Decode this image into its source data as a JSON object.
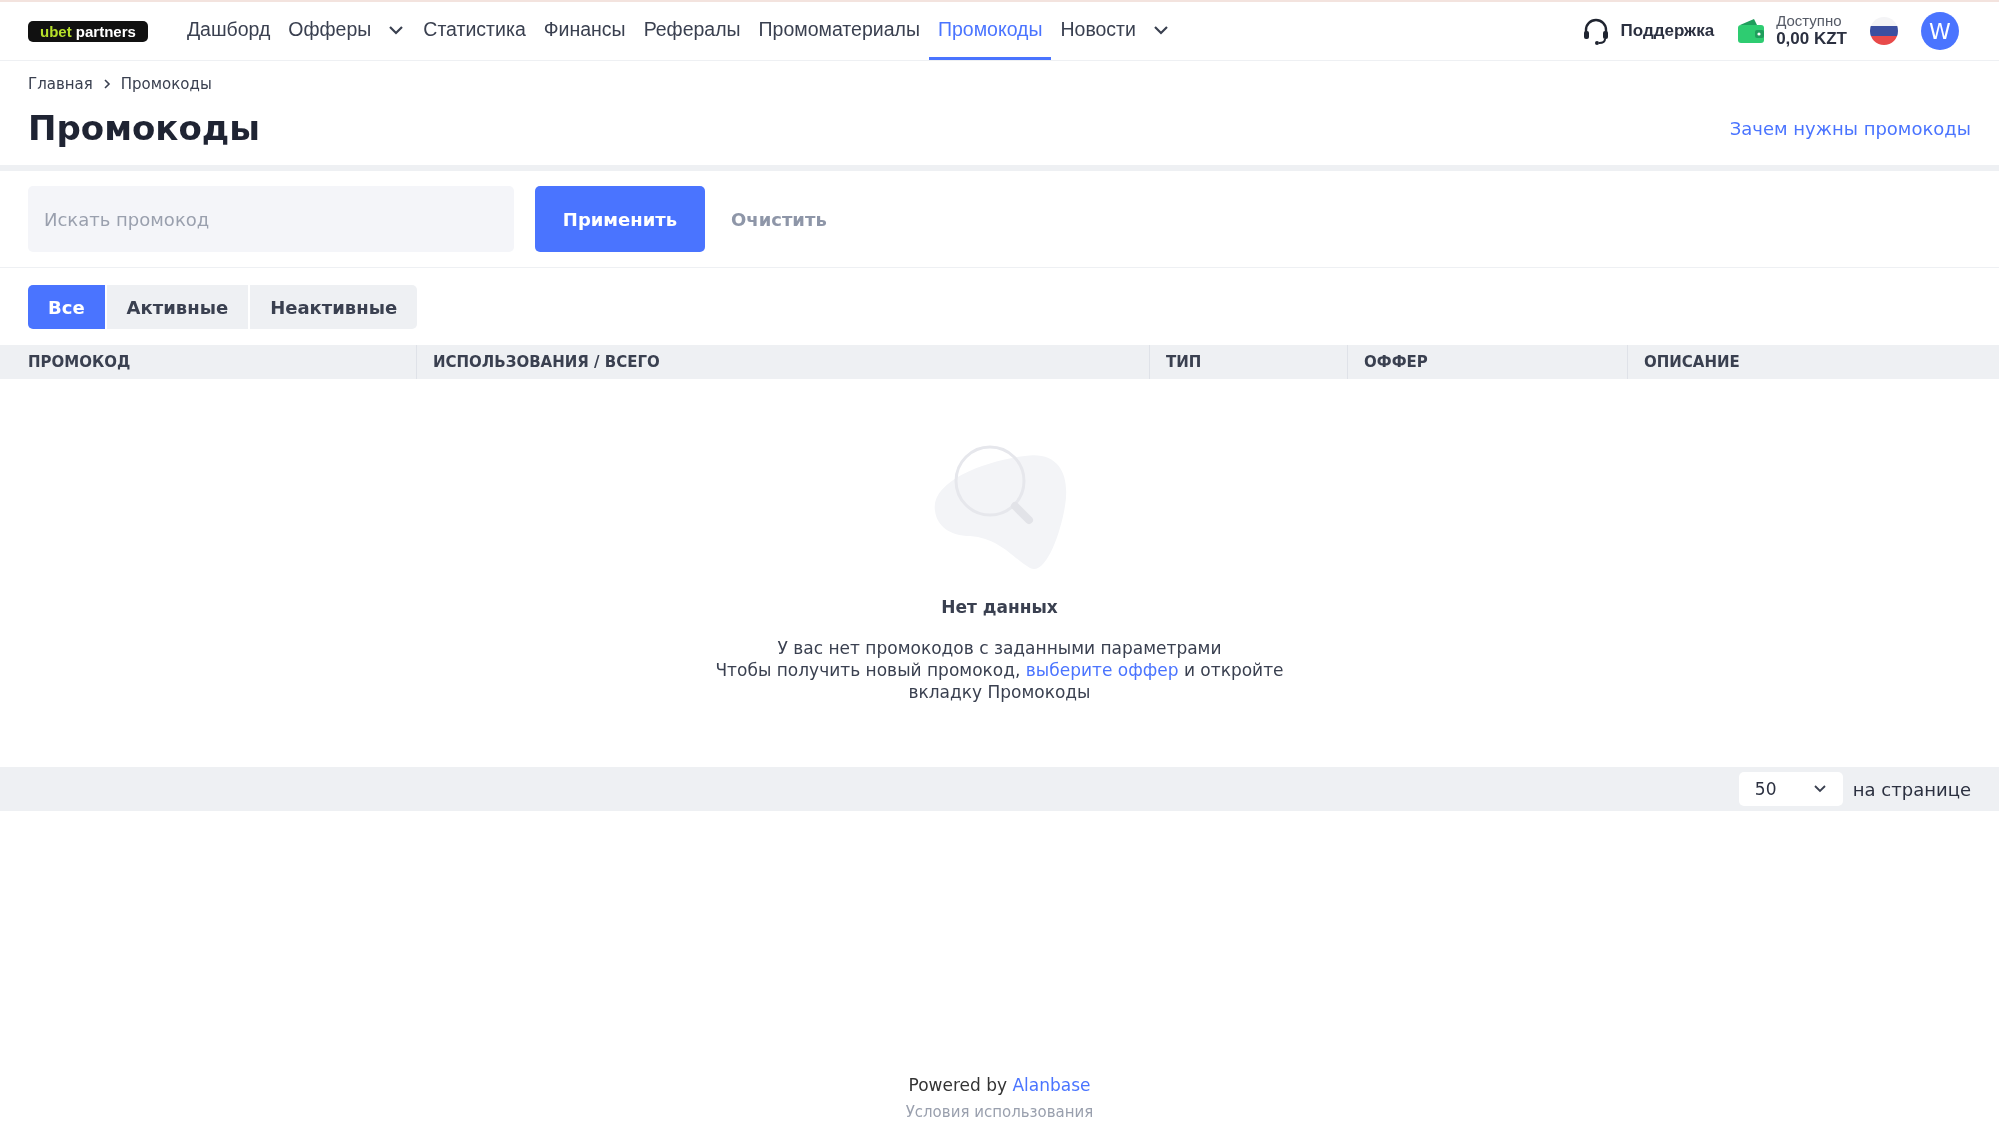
{
  "logo": {
    "brand": "ubet",
    "suffix": "partners"
  },
  "nav": [
    {
      "label": "Дашборд",
      "selected": false,
      "dropdown": false
    },
    {
      "label": "Офферы",
      "selected": false,
      "dropdown": true
    },
    {
      "label": "Статистика",
      "selected": false,
      "dropdown": false
    },
    {
      "label": "Финансы",
      "selected": false,
      "dropdown": false
    },
    {
      "label": "Рефералы",
      "selected": false,
      "dropdown": false
    },
    {
      "label": "Промоматериалы",
      "selected": false,
      "dropdown": false
    },
    {
      "label": "Промокоды",
      "selected": true,
      "dropdown": false
    },
    {
      "label": "Новости",
      "selected": false,
      "dropdown": true
    }
  ],
  "support": "Поддержка",
  "balance": {
    "label": "Доступно",
    "amount": "0,00 KZT"
  },
  "avatar": "W",
  "breadcrumbs": [
    "Главная",
    "Промокоды"
  ],
  "title": "Промокоды",
  "help_link": "Зачем нужны промокоды",
  "search": {
    "placeholder": "Искать промокод",
    "apply": "Применить",
    "clear": "Очистить"
  },
  "filters": [
    {
      "label": "Все",
      "selected": true
    },
    {
      "label": "Активные",
      "selected": false
    },
    {
      "label": "Неактивные",
      "selected": false
    }
  ],
  "table": {
    "columns": [
      "ПРОМОКОД",
      "ИСПОЛЬЗОВАНИЯ / ВСЕГО",
      "ТИП",
      "ОФФЕР",
      "ОПИСАНИЕ"
    ]
  },
  "empty": {
    "title": "Нет данных",
    "line1": "У вас нет промокодов с заданными параметрами",
    "before_link": "Чтобы получить новый промокод,",
    "link": "выберите оффер",
    "after_link": "и откройте",
    "line3": "вкладку Промокоды"
  },
  "pagination": {
    "per_page": "50",
    "label": "на странице"
  },
  "footer": {
    "powered": "Powered by",
    "brand": "Alanbase",
    "terms": "Условия использования"
  }
}
